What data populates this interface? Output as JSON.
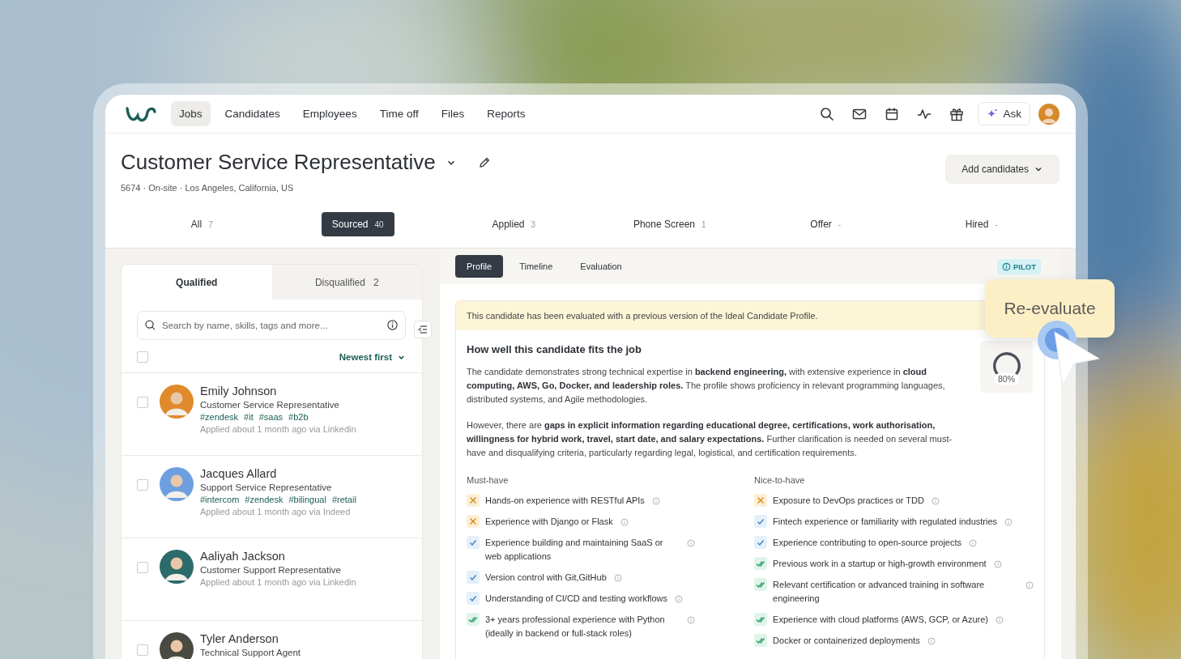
{
  "nav": {
    "items": [
      {
        "label": "Jobs",
        "selected": true
      },
      {
        "label": "Candidates",
        "selected": false
      },
      {
        "label": "Employees",
        "selected": false
      },
      {
        "label": "Time off",
        "selected": false
      },
      {
        "label": "Files",
        "selected": false
      },
      {
        "label": "Reports",
        "selected": false
      }
    ],
    "ask": "Ask"
  },
  "job": {
    "title": "Customer Service Representative",
    "meta": "5674 · On-site · Los Angeles, California, US",
    "add_button": "Add candidates"
  },
  "stages": [
    {
      "label": "All",
      "count": "7",
      "selected": false
    },
    {
      "label": "Sourced",
      "count": "40",
      "selected": true
    },
    {
      "label": "Applied",
      "count": "3",
      "selected": false
    },
    {
      "label": "Phone Screen",
      "count": "1",
      "selected": false
    },
    {
      "label": "Offer",
      "count": "-",
      "selected": false
    },
    {
      "label": "Hired",
      "count": "-",
      "selected": false
    }
  ],
  "list": {
    "tabs": [
      {
        "label": "Qualified",
        "selected": true
      },
      {
        "label": "Disqualified",
        "count": "2",
        "selected": false
      }
    ],
    "search": {
      "placeholder": "Search by name, skills, tags and more..."
    },
    "select_all": {
      "checked": false
    },
    "sort": "Newest first",
    "candidates": [
      {
        "name": "Emily Johnson",
        "title": "Customer Service Representative",
        "tags": [
          "#zendesk",
          "#it",
          "#saas",
          "#b2b"
        ],
        "source": "Applied about 1 month ago via Linkedin",
        "checked": false,
        "color": "#e08a2c"
      },
      {
        "name": "Jacques Allard",
        "title": "Support Service Representative",
        "tags": [
          "#intercom",
          "#zendesk",
          "#bilingual",
          "#retail"
        ],
        "source": "Applied about 1 month ago via Indeed",
        "checked": false,
        "color": "#6d9fe0"
      },
      {
        "name": "Aaliyah Jackson",
        "title": "Customer Support Representative",
        "source": "Applied about 1 month ago via Linkedin",
        "checked": false,
        "color": "#2b6b6a"
      },
      {
        "name": "Tyler Anderson",
        "title": "Technical Support Agent",
        "checked": false,
        "color": "#4a4a42"
      }
    ]
  },
  "profile": {
    "tabs": [
      {
        "label": "Profile",
        "selected": true
      },
      {
        "label": "Timeline",
        "selected": false
      },
      {
        "label": "Evaluation",
        "selected": false
      }
    ],
    "badge": "PILOT",
    "banner": "This candidate has been evaluated with a previous version of the Ideal Candidate Profile.",
    "heading": "How well this candidate fits the job",
    "paragraphs": [
      "The candidate demonstrates strong technical expertise in **backend engineering,** with extensive experience in **cloud computing, AWS, Go, Docker, and leadership roles.** The profile shows proficiency in relevant programming languages, distributed systems, and Agile methodologies.",
      "However, there are **gaps in explicit information regarding educational degree, certifications, work authorisation, willingness for hybrid work, travel, start date, and salary expectations.** Further clarification is needed on several must-have and disqualifying criteria, particularly regarding legal, logistical, and certification requirements."
    ],
    "score": {
      "label": "80%",
      "level": 0.8
    },
    "criteria": [
      {
        "title": "Must-have",
        "items": [
          {
            "kind": "miss",
            "text": "Hands-on experience with RESTful APIs"
          },
          {
            "kind": "miss",
            "text": "Experience with Django or Flask"
          },
          {
            "kind": "partial",
            "text": "Experience building and maintaining SaaS or web applications"
          },
          {
            "kind": "partial",
            "text": "Version control with Git,GitHub"
          },
          {
            "kind": "partial",
            "text": "Understanding of CI/CD and testing workflows"
          },
          {
            "kind": "full",
            "text": "3+ years professional experience with Python (ideally in backend or full-stack roles)"
          }
        ]
      },
      {
        "title": "Nice-to-have",
        "items": [
          {
            "kind": "miss",
            "text": "Exposure to DevOps practices or TDD"
          },
          {
            "kind": "partial",
            "text": "Fintech experience or familiarity with regulated industries"
          },
          {
            "kind": "partial",
            "text": "Experience contributing to open-source projects"
          },
          {
            "kind": "full",
            "text": "Previous work in a startup or high-growth environment"
          },
          {
            "kind": "full",
            "text": "Relevant certification or advanced training in software engineering"
          },
          {
            "kind": "full",
            "text": "Experience with cloud platforms (AWS, GCP, or Azure)"
          },
          {
            "kind": "full",
            "text": "Docker or containerized deployments"
          }
        ]
      }
    ]
  },
  "callout": "Re-evaluate"
}
